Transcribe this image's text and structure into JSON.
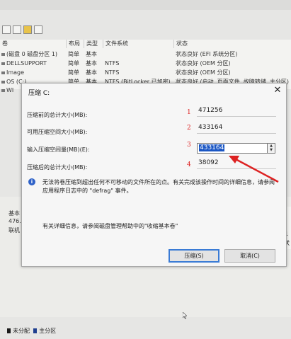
{
  "background": {
    "column_headers": [
      "卷",
      "布局",
      "类型",
      "文件系统",
      "状态"
    ],
    "rows": [
      {
        "volume": "(磁盘 0 磁盘分区 1)",
        "layout": "简单",
        "type": "基本",
        "fs": "",
        "status": "状态良好 (EFI 系统分区)"
      },
      {
        "volume": "DELLSUPPORT",
        "layout": "简单",
        "type": "基本",
        "fs": "NTFS",
        "status": "状态良好 (OEM 分区)"
      },
      {
        "volume": "Image",
        "layout": "简单",
        "type": "基本",
        "fs": "NTFS",
        "status": "状态良好 (OEM 分区)"
      },
      {
        "volume": "OS (C:)",
        "layout": "简单",
        "type": "基本",
        "fs": "NTFS (BitLocker 已加密)",
        "status": "状态良好 (启动, 页面文件, 故障转储, 主分区)"
      },
      {
        "volume": "WI",
        "layout": "",
        "type": "",
        "fs": "",
        "status": ""
      }
    ],
    "disk_labels": [
      "基本",
      "476.",
      "联机"
    ],
    "right_fragment": [
      "1",
      "状"
    ],
    "legend": [
      {
        "label": "未分配",
        "color": "#1a1a1a"
      },
      {
        "label": "主分区",
        "color": "#1f3f8f"
      }
    ]
  },
  "dialog": {
    "title": "压缩 C:",
    "close_glyph": "✕",
    "fields": [
      {
        "label": "压缩前的总计大小(MB):",
        "value": "471256",
        "marker": "1"
      },
      {
        "label": "可用压缩空间大小(MB):",
        "value": "433164",
        "marker": "2"
      },
      {
        "label": "输入压缩空间量(MB)(E):",
        "value": "433164",
        "marker": "3"
      },
      {
        "label": "压缩后的总计大小(MB):",
        "value": "38092",
        "marker": "4"
      }
    ],
    "spin_up": "▲",
    "spin_down": "▼",
    "info_icon": "i",
    "info_text": "无法将卷压缩到超出任何不可移动的文件所在的点。有关完成该操作时间的详细信息，请参阅应用程序日志中的 \"defrag\" 事件。",
    "help_text": "有关详细信息，请参阅磁盘管理帮助中的\"收缩基本卷\"",
    "shrink_button": "压缩(S)",
    "cancel_button": "取消(C)",
    "annotation_color": "#dd2222"
  }
}
